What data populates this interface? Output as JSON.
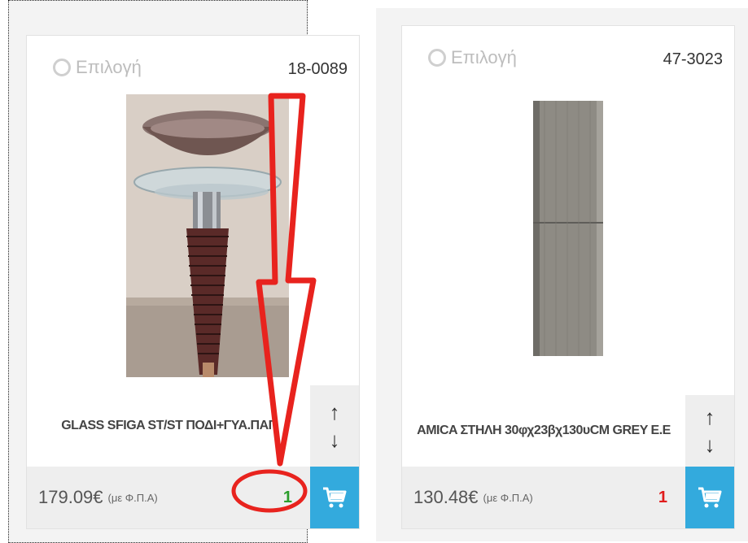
{
  "colors": {
    "accent": "#33aadd",
    "stock_ok": "#2a9d2a",
    "stock_low": "#e01c1c",
    "annotation": "#e8231e"
  },
  "products": [
    {
      "select_label": "Επιλογή",
      "code": "18-0089",
      "title": "GLASS SFIGA ST/ST ΠΟΔΙ+ΓΥΑ.ΠΑΓ",
      "price": "179.09€",
      "price_note": "(με Φ.Π.Α)",
      "stock": "1",
      "stock_color": "#2a9d2a",
      "up_icon": "↑",
      "down_icon": "↓"
    },
    {
      "select_label": "Επιλογή",
      "code": "47-3023",
      "title": "AMICA ΣΤΗΛΗ 30φχ23βχ130υCM GREY E.E",
      "price": "130.48€",
      "price_note": "(με Φ.Π.Α)",
      "stock": "1",
      "stock_color": "#e01c1c",
      "up_icon": "↑",
      "down_icon": "↓"
    }
  ]
}
